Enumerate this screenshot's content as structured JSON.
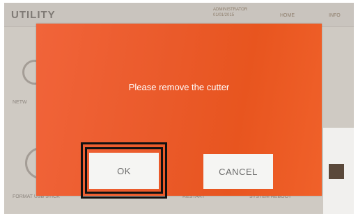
{
  "app": {
    "title": "UTILITY",
    "status_user": "ADMINISTRATOR",
    "status_date": "01/01/2015",
    "nav_home": "HOME",
    "nav_info": "INFO"
  },
  "background_tiles": {
    "network_label": "NETW",
    "format_label": "FORMAT USB STICK",
    "restart_label": "RESTART",
    "reboot_label": "SYSTEM REBOOT"
  },
  "modal": {
    "message": "Please remove the cutter",
    "ok_label": "OK",
    "cancel_label": "CANCEL",
    "bg_color": "#ea5a2a"
  },
  "icons": {
    "network": "network-icon",
    "usb": "usb-icon",
    "square": "square-icon"
  }
}
